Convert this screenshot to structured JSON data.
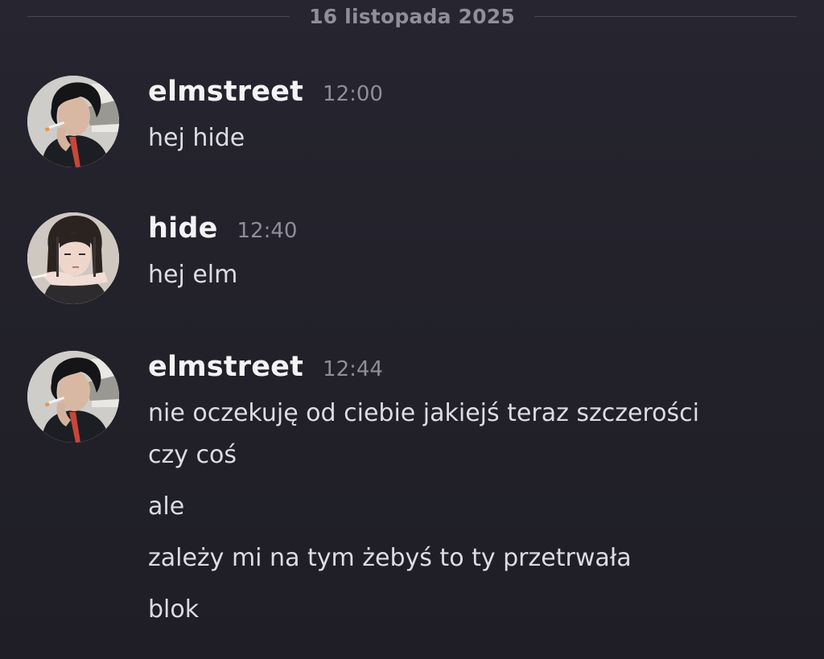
{
  "chat": {
    "date_divider": "16 listopada 2025",
    "messages": [
      {
        "author": "elmstreet",
        "time": "12:00",
        "avatar_icon": "elmstreet-avatar",
        "lines": [
          "hej hide"
        ]
      },
      {
        "author": "hide",
        "time": "12:40",
        "avatar_icon": "hide-avatar",
        "lines": [
          "hej elm"
        ]
      },
      {
        "author": "elmstreet",
        "time": "12:44",
        "avatar_icon": "elmstreet-avatar",
        "lines": [
          "nie oczekuję od ciebie jakiejś teraz szczerości",
          "czy coś",
          "ale",
          "zależy mi na tym żebyś to ty przetrwała",
          "blok"
        ]
      }
    ]
  }
}
